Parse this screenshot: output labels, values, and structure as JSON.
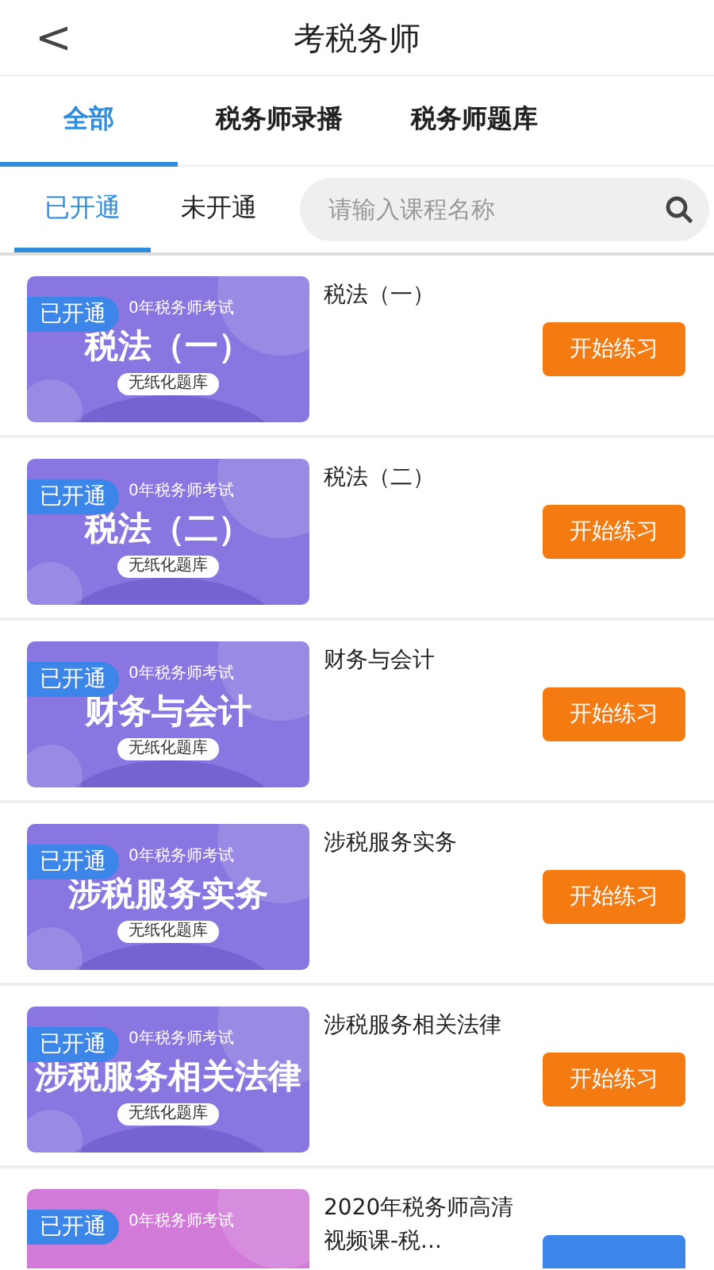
{
  "header": {
    "back": "<",
    "title": "考税务师"
  },
  "tabs": [
    {
      "label": "全部",
      "selected": true
    },
    {
      "label": "税务师录播",
      "selected": false
    },
    {
      "label": "税务师题库",
      "selected": false
    }
  ],
  "subtabs": [
    {
      "label": "已开通",
      "selected": true
    },
    {
      "label": "未开通",
      "selected": false
    }
  ],
  "search": {
    "placeholder": "请输入课程名称"
  },
  "courses": [
    {
      "badge": "已开通",
      "banner_top": "0年税务师考试",
      "banner_title": "税法（一）",
      "banner_tag": "无纸化题库",
      "color": "#8a76e0",
      "name": "税法（一）",
      "button": "开始练习",
      "kind": "practice"
    },
    {
      "badge": "已开通",
      "banner_top": "0年税务师考试",
      "banner_title": "税法（二）",
      "banner_tag": "无纸化题库",
      "color": "#8a76e0",
      "name": "税法（二）",
      "button": "开始练习",
      "kind": "practice"
    },
    {
      "badge": "已开通",
      "banner_top": "0年税务师考试",
      "banner_title": "财务与会计",
      "banner_tag": "无纸化题库",
      "color": "#8a76e0",
      "name": "财务与会计",
      "button": "开始练习",
      "kind": "practice"
    },
    {
      "badge": "已开通",
      "banner_top": "0年税务师考试",
      "banner_title": "涉税服务实务",
      "banner_tag": "无纸化题库",
      "color": "#8a76e0",
      "name": "涉税服务实务",
      "button": "开始练习",
      "kind": "practice"
    },
    {
      "badge": "已开通",
      "banner_top": "0年税务师考试",
      "banner_title": "涉税服务相关法律",
      "banner_tag": "无纸化题库",
      "color": "#8a76e0",
      "name": "涉税服务相关法律",
      "button": "开始练习",
      "kind": "practice"
    },
    {
      "badge": "已开通",
      "banner_top": "0年税务师考试",
      "color": "#d17ad8",
      "name": "2020年税务师高清视频课-税...",
      "kind": "listen"
    }
  ]
}
